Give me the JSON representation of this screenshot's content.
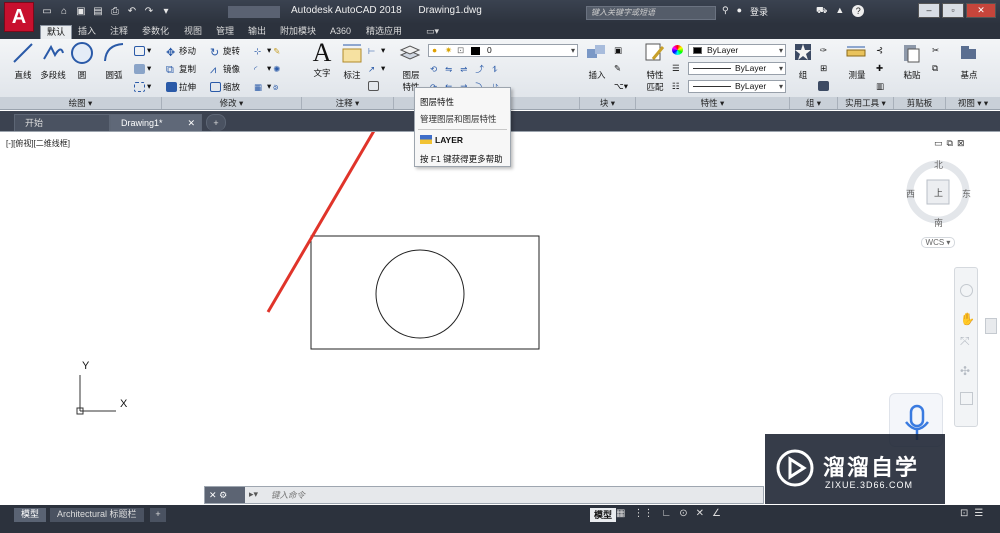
{
  "app": {
    "logo_letter": "A",
    "title": "Autodesk AutoCAD 2018",
    "document": "Drawing1.dwg",
    "search_placeholder": "键入关键字或短语",
    "login": "登录"
  },
  "ribbon_tabs": [
    "默认",
    "插入",
    "注释",
    "参数化",
    "视图",
    "管理",
    "输出",
    "附加模块",
    "A360",
    "精选应用"
  ],
  "ribbon": {
    "draw": {
      "title": "绘图",
      "line": "直线",
      "polyline": "多段线",
      "circle": "圆",
      "arc": "圆弧"
    },
    "modify": {
      "title": "修改",
      "move": "移动",
      "rotate": "旋转",
      "copy": "复制",
      "mirror": "镜像",
      "stretch": "拉伸",
      "scale": "缩放"
    },
    "annotation": {
      "title": "注释",
      "text": "文字",
      "dimension": "标注"
    },
    "layers": {
      "title": "图层",
      "layer_props": "图层",
      "layer_props2": "特性",
      "layer_value": "0"
    },
    "block": {
      "title": "块",
      "insert": "插入"
    },
    "properties": {
      "title": "特性",
      "match": "特性",
      "match2": "匹配",
      "bylayer1": "ByLayer",
      "bylayer2": "ByLayer",
      "bylayer3": "ByLayer"
    },
    "groups": {
      "title": "组",
      "group": "组"
    },
    "utilities": {
      "title": "实用工具",
      "measure": "测量"
    },
    "clipboard": {
      "title": "剪贴板",
      "paste": "粘贴"
    },
    "view": {
      "title": "视图",
      "base": "基点"
    }
  },
  "file_tabs": [
    "开始",
    "Drawing1*"
  ],
  "viewport_label": "[-][俯视][二维线框]",
  "tooltip": {
    "title": "图层特性",
    "desc": "管理图层和图层特性",
    "command": "LAYER",
    "help": "按 F1 键获得更多帮助"
  },
  "compass": {
    "north": "北",
    "south": "南",
    "east": "东",
    "west": "西",
    "center": "上",
    "wcs": "WCS"
  },
  "ucs": {
    "x": "X",
    "y": "Y"
  },
  "cmdline": {
    "placeholder": "键入命令"
  },
  "status_tabs": [
    "模型",
    "Architectural 标题栏"
  ],
  "status_model": "模型",
  "watermark": {
    "title": "溜溜自学",
    "url": "ZIXUE.3D66.COM"
  },
  "colors": {
    "accent_red": "#e0342a",
    "autocad_red": "#c8102e",
    "dark_ui": "#2c323d"
  }
}
